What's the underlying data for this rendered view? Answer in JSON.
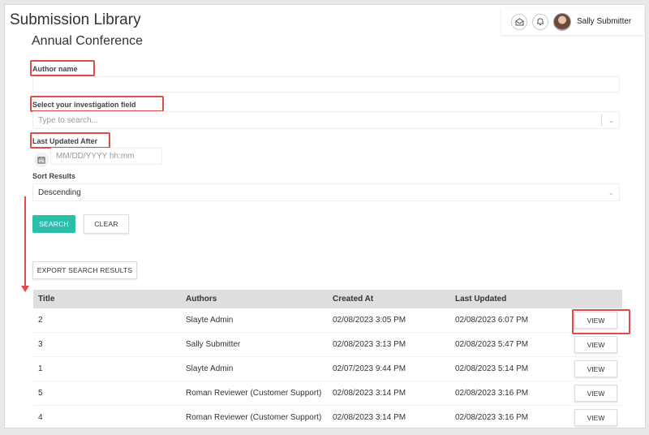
{
  "page": {
    "title": "Submission Library",
    "subtitle": "Annual Conference"
  },
  "header": {
    "user_name": "Sally Submitter",
    "icons": [
      "inbox-icon",
      "bell-icon",
      "avatar"
    ]
  },
  "filters": {
    "author": {
      "label": "Author name",
      "value": ""
    },
    "field": {
      "label": "Select your investigation field",
      "placeholder": "Type to search..."
    },
    "updated": {
      "label": "Last Updated After",
      "placeholder": "MM/DD/YYYY hh:mm"
    },
    "sort": {
      "label": "Sort Results",
      "value": "Descending"
    }
  },
  "actions": {
    "search": "SEARCH",
    "clear": "CLEAR",
    "export": "EXPORT SEARCH RESULTS"
  },
  "table": {
    "columns": [
      "Title",
      "Authors",
      "Created At",
      "Last Updated"
    ],
    "view_label": "VIEW",
    "rows": [
      {
        "title": "2",
        "authors": "Slayte Admin",
        "created": "02/08/2023 3:05 PM",
        "updated": "02/08/2023 6:07 PM"
      },
      {
        "title": "3",
        "authors": "Sally Submitter",
        "created": "02/08/2023 3:13 PM",
        "updated": "02/08/2023 5:47 PM"
      },
      {
        "title": "1",
        "authors": "Slayte Admin",
        "created": "02/07/2023 9:44 PM",
        "updated": "02/08/2023 5:14 PM"
      },
      {
        "title": "5",
        "authors": "Roman Reviewer (Customer Support)",
        "created": "02/08/2023 3:14 PM",
        "updated": "02/08/2023 3:16 PM"
      },
      {
        "title": "4",
        "authors": "Roman Reviewer (Customer Support)",
        "created": "02/08/2023 3:14 PM",
        "updated": "02/08/2023 3:16 PM"
      }
    ]
  },
  "colors": {
    "accent": "#2bbfa9",
    "highlight": "#e04a4a"
  }
}
